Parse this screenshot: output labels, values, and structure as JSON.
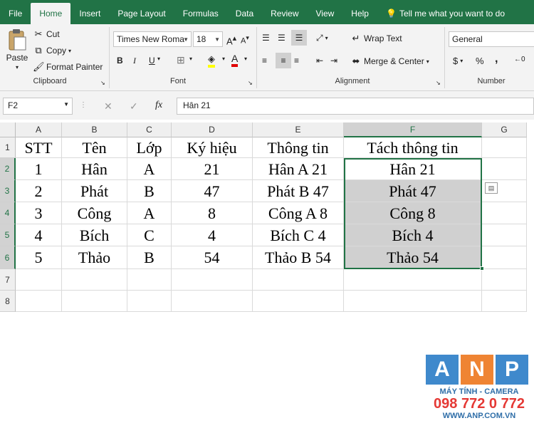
{
  "tabs": {
    "file": "File",
    "home": "Home",
    "insert": "Insert",
    "page_layout": "Page Layout",
    "formulas": "Formulas",
    "data": "Data",
    "review": "Review",
    "view": "View",
    "help": "Help",
    "tell_me": "Tell me what you want to do"
  },
  "clipboard": {
    "paste": "Paste",
    "cut": "Cut",
    "copy": "Copy",
    "format_painter": "Format Painter",
    "group": "Clipboard"
  },
  "font": {
    "name": "Times New Roma",
    "size": "18",
    "group": "Font",
    "bold": "B",
    "italic": "I",
    "underline": "U",
    "font_color_glyph": "A"
  },
  "alignment": {
    "wrap_text": "Wrap Text",
    "merge_center": "Merge & Center",
    "group": "Alignment"
  },
  "number": {
    "format": "General",
    "group": "Number",
    "dollar": "$",
    "percent": "%",
    "comma": ","
  },
  "formula_bar": {
    "name_box": "F2",
    "fx": "fx",
    "content": "Hân 21"
  },
  "columns": [
    "A",
    "B",
    "C",
    "D",
    "E",
    "F",
    "G"
  ],
  "rows": [
    "1",
    "2",
    "3",
    "4",
    "5",
    "6",
    "7",
    "8"
  ],
  "headers": [
    "STT",
    "Tên",
    "Lớp",
    "Ký hiệu",
    "Thông tin",
    "Tách thông tin"
  ],
  "data": [
    [
      "1",
      "Hân",
      "A",
      "21",
      "Hân A 21",
      "Hân 21"
    ],
    [
      "2",
      "Phát",
      "B",
      "47",
      "Phát B 47",
      "Phát 47"
    ],
    [
      "3",
      "Công",
      "A",
      "8",
      "Công A 8",
      "Công 8"
    ],
    [
      "4",
      "Bích",
      "C",
      "4",
      "Bích C 4",
      "Bích 4"
    ],
    [
      "5",
      "Thảo",
      "B",
      "54",
      "Thảo B 54",
      "Thảo 54"
    ]
  ],
  "watermark": {
    "l1": "A",
    "l2": "N",
    "l3": "P",
    "tagline": "MÁY TÍNH - CAMERA",
    "phone": "098 772 0 772",
    "url": "WWW.ANP.COM.VN"
  },
  "colors": {
    "accent": "#217346",
    "selected_fill": "#d0d0d0"
  }
}
